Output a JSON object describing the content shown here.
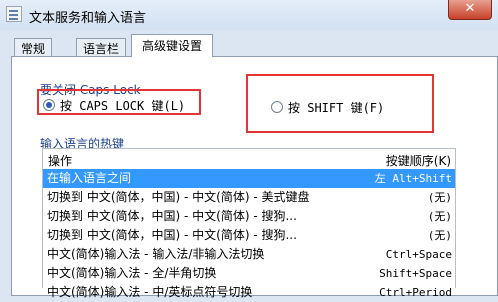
{
  "window": {
    "title": "文本服务和输入语言",
    "close_symbol": "✕"
  },
  "tabs": [
    {
      "label": "常规"
    },
    {
      "label": "语言栏"
    },
    {
      "label": "高级键设置"
    }
  ],
  "caps_group": {
    "label": "要关闭 Caps Lock",
    "option1": "按 CAPS LOCK 键(L)",
    "option2": "按 SHIFT 键(F)",
    "selected": "option1"
  },
  "hotkeys": {
    "label": "输入语言的热键",
    "col_action": "操作",
    "col_key": "按键顺序(K)",
    "rows": [
      {
        "action": "在输入语言之间",
        "key": "左 Alt+Shift"
      },
      {
        "action": "切换到 中文(简体，中国) - 中文(简体) - 美式键盘",
        "key": "(无)"
      },
      {
        "action": "切换到 中文(简体，中国) - 中文(简体) - 搜狗...",
        "key": "(无)"
      },
      {
        "action": "切换到 中文(简体，中国) - 中文(简体) - 搜狗...",
        "key": "(无)"
      },
      {
        "action": "中文(简体)输入法 - 输入法/非输入法切换",
        "key": "Ctrl+Space"
      },
      {
        "action": "中文(简体)输入法 - 全/半角切换",
        "key": "Shift+Space"
      },
      {
        "action": "中文(简体)输入法 - 中/英标点符号切换",
        "key": "Ctrl+Period"
      }
    ]
  },
  "colors": {
    "highlight": "#3399ff",
    "annotation_red": "#e53434"
  }
}
